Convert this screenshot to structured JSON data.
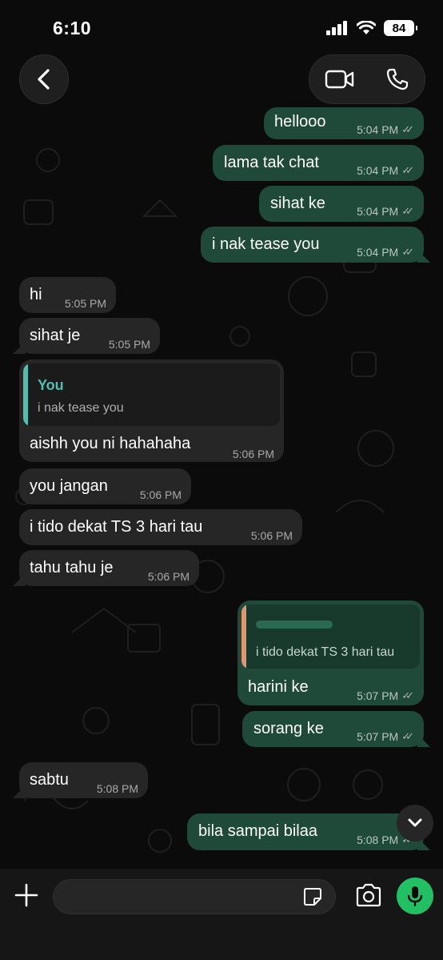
{
  "status_bar": {
    "time": "6:10",
    "battery": "84"
  },
  "header": {
    "back_icon": "chevron-left-icon",
    "video_icon": "video-camera-icon",
    "call_icon": "phone-icon"
  },
  "messages": [
    {
      "dir": "out",
      "text": "hellooo",
      "time": "5:04 PM"
    },
    {
      "dir": "out",
      "text": "lama tak chat",
      "time": "5:04 PM"
    },
    {
      "dir": "out",
      "text": "sihat ke",
      "time": "5:04 PM"
    },
    {
      "dir": "out",
      "text": "i nak tease you",
      "time": "5:04 PM"
    },
    {
      "dir": "in",
      "text": "hi",
      "time": "5:05 PM"
    },
    {
      "dir": "in",
      "text": "sihat je",
      "time": "5:05 PM"
    },
    {
      "dir": "in",
      "text": "aishh you ni hahahaha",
      "time": "5:06 PM",
      "reply": {
        "author": "You",
        "text": "i nak tease you"
      }
    },
    {
      "dir": "in",
      "text": "you jangan",
      "time": "5:06 PM"
    },
    {
      "dir": "in",
      "text": "i tido dekat TS 3 hari tau",
      "time": "5:06 PM"
    },
    {
      "dir": "in",
      "text": "tahu tahu je",
      "time": "5:06 PM"
    },
    {
      "dir": "out",
      "text": "harini ke",
      "time": "5:07 PM",
      "reply": {
        "author": "",
        "text": "i tido dekat TS 3 hari tau"
      }
    },
    {
      "dir": "out",
      "text": "sorang ke",
      "time": "5:07 PM"
    },
    {
      "dir": "in",
      "text": "sabtu",
      "time": "5:08 PM"
    },
    {
      "dir": "out",
      "text": "bila sampai bilaa",
      "time": "5:08 PM"
    }
  ],
  "colors": {
    "outgoing_bubble": "#1f4a3a",
    "incoming_bubble": "#262626",
    "reply_you": "#53bdae",
    "reply_contact": "#e4956f",
    "mic_button": "#21c063"
  },
  "composer": {
    "plus_icon": "plus-icon",
    "sticker_icon": "sticker-icon",
    "camera_icon": "camera-icon",
    "mic_icon": "microphone-icon"
  },
  "scroll_icon": "chevron-down-icon"
}
